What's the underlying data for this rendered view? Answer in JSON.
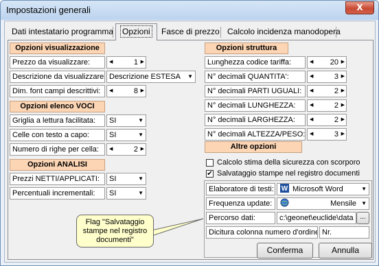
{
  "window": {
    "title": "Impostazioni generali",
    "close_label": "X"
  },
  "tabs": [
    "Dati intestatario programma",
    "Opzioni",
    "Fasce di prezzo",
    "Calcolo incidenza manodopera"
  ],
  "visualizzazione": {
    "title": "Opzioni visualizzazione",
    "prezzo_label": "Prezzo da visualizzare:",
    "prezzo_value": "1",
    "descrizione_label": "Descrizione da visualizzare:",
    "descrizione_value": "Descrizione ESTESA",
    "font_label": "Dim. font campi descrittivi:",
    "font_value": "8"
  },
  "voci": {
    "title": "Opzioni elenco VOCI",
    "griglia_label": "Griglia a lettura facilitata:",
    "griglia_value": "SI",
    "celle_label": "Celle con testo a capo:",
    "celle_value": "SI",
    "righe_label": "Numero di righe per cella:",
    "righe_value": "2"
  },
  "analisi": {
    "title": "Opzioni ANALISI",
    "prezzi_label": "Prezzi NETTI/APPLICATI:",
    "prezzi_value": "SI",
    "perc_label": "Percentuali incrementali:",
    "perc_value": "SI"
  },
  "struttura": {
    "title": "Opzioni struttura",
    "rows": [
      {
        "label": "Lunghezza codice tariffa:",
        "value": "20"
      },
      {
        "label": "N° decimali QUANTITA':",
        "value": "3"
      },
      {
        "label": "N° decimali PARTI UGUALI:",
        "value": "2"
      },
      {
        "label": "N° decimali LUNGHEZZA:",
        "value": "2"
      },
      {
        "label": "N° decimali LARGHEZZA:",
        "value": "2"
      },
      {
        "label": "N° decimali ALTEZZA/PESO:",
        "value": "3"
      }
    ]
  },
  "altre": {
    "title": "Altre opzioni",
    "check1_label": "Calcolo stima della sicurezza  con scorporo",
    "check1_checked": false,
    "check2_label": "Salvataggio stampe nel registro documenti",
    "check2_checked": true,
    "elaboratore_label": "Elaboratore di testi:",
    "elaboratore_value": "Microsoft Word",
    "frequenza_label": "Frequenza update:",
    "frequenza_value": "Mensile",
    "percorso_label": "Percorso dati:",
    "percorso_value": "c:\\geonet\\euclide\\data",
    "percorso_button": "...",
    "dicitura_label": "Dicitura colonna numero d'ordine:",
    "dicitura_value": "Nr."
  },
  "tooltip": {
    "text": "Flag \"Salvataggio stampe nel registro documenti\""
  },
  "buttons": {
    "confirm": "Conferma",
    "cancel": "Annulla"
  },
  "colors": {
    "section_header": "#fcd5b4",
    "tooltip_bg": "#ffffcc",
    "close_button": "#c74a34"
  }
}
